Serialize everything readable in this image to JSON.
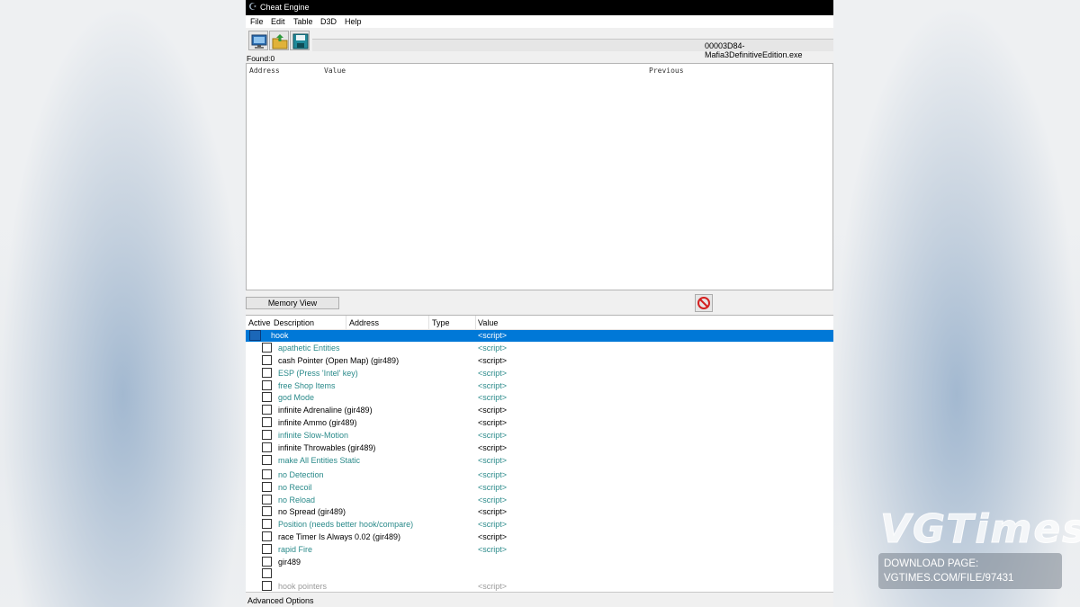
{
  "window": {
    "title": "Cheat Engine"
  },
  "menu": [
    "File",
    "Edit",
    "Table",
    "D3D",
    "Help"
  ],
  "toolbar": {
    "buttons": [
      "open-process-icon",
      "open-file-icon",
      "save-icon"
    ],
    "process_name": "00003D84-Mafia3DefinitiveEdition.exe"
  },
  "scan": {
    "found_label": "Found:0",
    "columns": [
      "Address",
      "Value",
      "Previous"
    ]
  },
  "memory_view_label": "Memory View",
  "table": {
    "columns": [
      "Active",
      "Description",
      "Address",
      "Type",
      "Value"
    ],
    "rows": [
      {
        "desc": "hook",
        "val": "<script>"
      },
      {
        "desc": "apathetic Entities",
        "val": "<script>"
      },
      {
        "desc": "cash Pointer (Open Map) (gir489)",
        "val": "<script>"
      },
      {
        "desc": "ESP (Press 'Intel' key)",
        "val": "<script>"
      },
      {
        "desc": "free Shop Items",
        "val": "<script>"
      },
      {
        "desc": "god Mode",
        "val": "<script>"
      },
      {
        "desc": "infinite Adrenaline (gir489)",
        "val": "<script>"
      },
      {
        "desc": "infinite Ammo (gir489)",
        "val": "<script>"
      },
      {
        "desc": "infinite Slow-Motion",
        "val": "<script>"
      },
      {
        "desc": "infinite Throwables (gir489)",
        "val": "<script>"
      },
      {
        "desc": "make All Entities Static",
        "val": "<script>"
      },
      {
        "desc": "no Detection",
        "val": "<script>"
      },
      {
        "desc": "no Recoil",
        "val": "<script>"
      },
      {
        "desc": "no Reload",
        "val": "<script>"
      },
      {
        "desc": "no Spread (gir489)",
        "val": "<script>"
      },
      {
        "desc": "Position (needs better hook/compare)",
        "val": "<script>"
      },
      {
        "desc": "race Timer Is Always 0.02 (gir489)",
        "val": "<script>"
      },
      {
        "desc": "rapid Fire",
        "val": "<script>"
      },
      {
        "desc": "gir489",
        "val": ""
      },
      {
        "desc": "",
        "val": ""
      },
      {
        "desc": "hook pointers",
        "val": "<script>"
      }
    ]
  },
  "advanced_label": "Advanced Options",
  "watermark": {
    "logo": "VGTimes",
    "line1": "DOWNLOAD PAGE:",
    "line2": "VGTIMES.COM/FILE/97431"
  },
  "colors": {
    "selection": "#0078d7",
    "script_teal": "#2a8a8a",
    "titlebar": "#000000"
  }
}
